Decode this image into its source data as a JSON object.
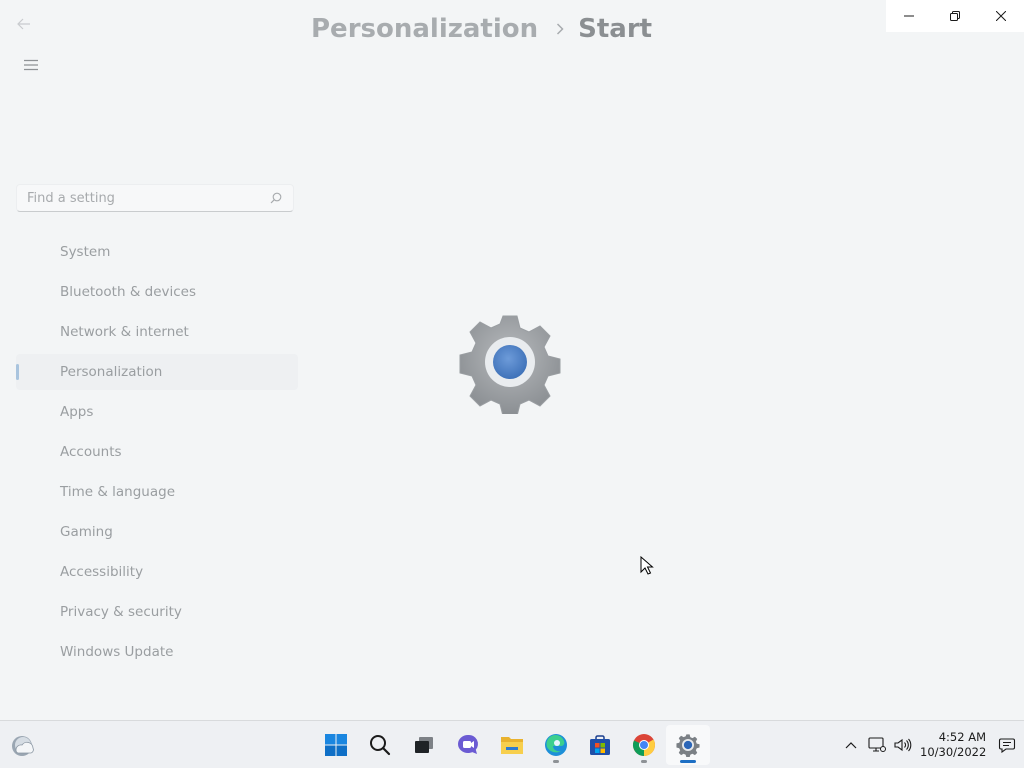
{
  "header": {
    "breadcrumb_parent": "Personalization",
    "breadcrumb_current": "Start"
  },
  "search": {
    "placeholder": "Find a setting"
  },
  "sidebar": {
    "items": [
      {
        "label": "System"
      },
      {
        "label": "Bluetooth & devices"
      },
      {
        "label": "Network & internet"
      },
      {
        "label": "Personalization",
        "active": true
      },
      {
        "label": "Apps"
      },
      {
        "label": "Accounts"
      },
      {
        "label": "Time & language"
      },
      {
        "label": "Gaming"
      },
      {
        "label": "Accessibility"
      },
      {
        "label": "Privacy & security"
      },
      {
        "label": "Windows Update"
      }
    ]
  },
  "taskbar": {
    "apps": [
      "start-icon",
      "search-icon",
      "task-view-icon",
      "chat-icon",
      "file-explorer-icon",
      "edge-icon",
      "store-icon",
      "chrome-icon",
      "settings-icon"
    ],
    "clock": {
      "time": "4:52 AM",
      "date": "10/30/2022"
    }
  },
  "colors": {
    "accent": "#1d6fc4",
    "background": "#f3f5f6",
    "taskbar": "#eef0f3"
  }
}
